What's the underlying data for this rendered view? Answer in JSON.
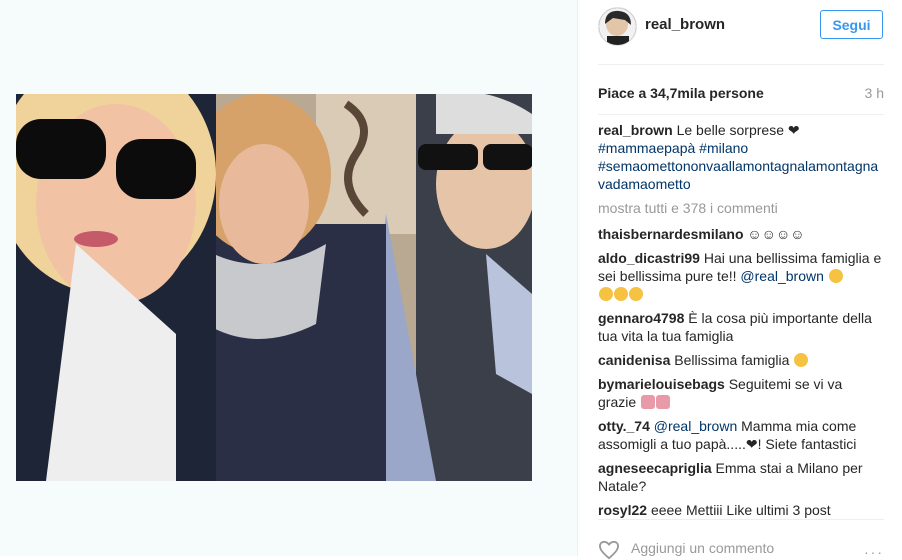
{
  "post": {
    "username": "real_brown",
    "follow_label": "Segui",
    "likes": "Piace a 34,7mila persone",
    "time": "3 h",
    "caption_text": "Le belle sorprese ❤",
    "hashtags": [
      "#mammaepapà",
      "#milano",
      "#semaomettononvaallamontagnalamontagnavadamaometto"
    ],
    "show_all_comments": "mostra tutti e 378 i commenti",
    "add_comment_placeholder": "Aggiungi un commento",
    "more_label": "···"
  },
  "comments": [
    {
      "user": "thaisbernardesmilano",
      "text": "☺☺☺☺"
    },
    {
      "user": "aldo_dicastri99",
      "text": "Hai una bellissima famiglia e sei bellissima pure te!! ",
      "mention": "@real_brown",
      "emojis": 4
    },
    {
      "user": "gennaro4798",
      "text": "È la cosa più importante della tua vita la tua famiglia"
    },
    {
      "user": "canidenisa",
      "text": "Bellissima famiglia",
      "emojis": 1
    },
    {
      "user": "bymarielouisebags",
      "text": "Seguitemi se vi va grazie",
      "emojis_pink": 2
    },
    {
      "user": "otty._74",
      "mention": "@real_brown",
      "text": " Mamma mia come assomigli a tuo papà.....❤! Siete fantastici"
    },
    {
      "user": "agneseecapriglia",
      "text": "Emma stai a Milano per Natale?"
    },
    {
      "user": "rosyl22",
      "text": "eeee Mettiii Like ultimi 3 post"
    }
  ],
  "colors": {
    "accent": "#3897f0",
    "hashtag": "#003569",
    "muted": "#999999"
  },
  "icons": {
    "like": "heart-outline-icon",
    "more": "more-options-icon"
  }
}
